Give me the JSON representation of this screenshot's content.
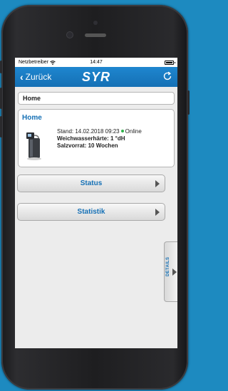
{
  "statusbar": {
    "carrier": "Netzbetreiber",
    "time": "14:47"
  },
  "navbar": {
    "back_label": "Zurück",
    "logo": "SYR",
    "refresh_icon": "refresh-icon"
  },
  "home_field": {
    "value": "Home"
  },
  "device": {
    "name": "Home",
    "stand": "Stand: 14.02.2018 09:23",
    "online": "Online",
    "haerte": "Weichwasserhärte: 1 °dH",
    "salz": "Salzvorrat: 10 Wochen",
    "online_color": "#2fb24a"
  },
  "buttons": {
    "status": "Status",
    "statistik": "Statistik"
  },
  "details_tab": {
    "label": "DETAILS"
  },
  "colors": {
    "background": "#1d8ac0",
    "navbar": "#1570b5",
    "accent": "#1570b5"
  }
}
